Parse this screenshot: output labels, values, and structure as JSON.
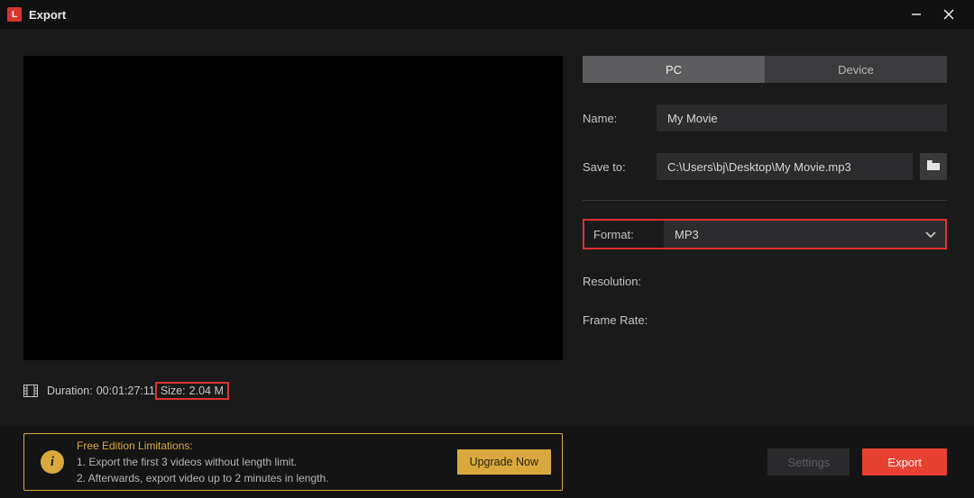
{
  "titlebar": {
    "title": "Export",
    "icon_letter": "L"
  },
  "meta": {
    "duration_label": "Duration:",
    "duration_value": "00:01:27:11",
    "size_label": "Size:",
    "size_value": "2.04 M"
  },
  "tabs": {
    "pc": "PC",
    "device": "Device"
  },
  "form": {
    "name_label": "Name:",
    "name_value": "My Movie",
    "saveto_label": "Save to:",
    "saveto_value": "C:\\Users\\bj\\Desktop\\My Movie.mp3",
    "format_label": "Format:",
    "format_value": "MP3",
    "resolution_label": "Resolution:",
    "framerate_label": "Frame Rate:"
  },
  "limitations": {
    "title": "Free Edition Limitations:",
    "line1": "1. Export the first 3 videos without length limit.",
    "line2": "2. Afterwards, export video up to 2 minutes in length.",
    "upgrade": "Upgrade Now"
  },
  "buttons": {
    "settings": "Settings",
    "export": "Export"
  }
}
